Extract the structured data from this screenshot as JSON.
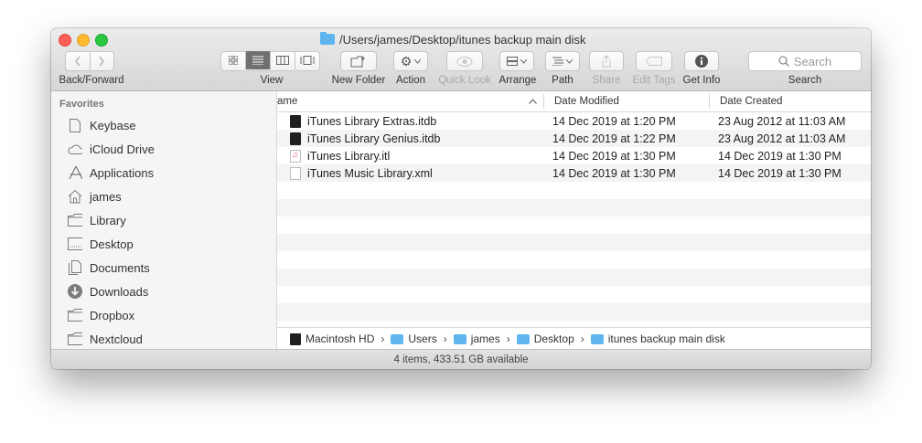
{
  "window": {
    "title": "/Users/james/Desktop/itunes backup main disk"
  },
  "toolbar": {
    "back_forward_label": "Back/Forward",
    "view_label": "View",
    "new_folder_label": "New Folder",
    "action_label": "Action",
    "quick_look_label": "Quick Look",
    "arrange_label": "Arrange",
    "path_label": "Path",
    "share_label": "Share",
    "edit_tags_label": "Edit Tags",
    "get_info_label": "Get Info",
    "search_label": "Search",
    "search_placeholder": "Search"
  },
  "sidebar": {
    "heading": "Favorites",
    "items": [
      {
        "label": "Keybase",
        "icon": "document-icon"
      },
      {
        "label": "iCloud Drive",
        "icon": "cloud-icon"
      },
      {
        "label": "Applications",
        "icon": "applications-icon"
      },
      {
        "label": "james",
        "icon": "home-icon"
      },
      {
        "label": "Library",
        "icon": "folder-icon"
      },
      {
        "label": "Desktop",
        "icon": "desktop-icon"
      },
      {
        "label": "Documents",
        "icon": "documents-icon"
      },
      {
        "label": "Downloads",
        "icon": "downloads-icon"
      },
      {
        "label": "Dropbox",
        "icon": "folder-icon"
      },
      {
        "label": "Nextcloud",
        "icon": "folder-icon"
      }
    ]
  },
  "columns": {
    "name": "ame",
    "date_modified": "Date Modified",
    "date_created": "Date Created"
  },
  "files": [
    {
      "name": "iTunes Library Extras.itdb",
      "modified": "14 Dec 2019 at 1:20 PM",
      "created": "23 Aug 2012 at 11:03 AM",
      "icon": "database-file-icon"
    },
    {
      "name": "iTunes Library Genius.itdb",
      "modified": "14 Dec 2019 at 1:22 PM",
      "created": "23 Aug 2012 at 11:03 AM",
      "icon": "database-file-icon"
    },
    {
      "name": "iTunes Library.itl",
      "modified": "14 Dec 2019 at 1:30 PM",
      "created": "14 Dec 2019 at 1:30 PM",
      "icon": "itunes-library-file-icon"
    },
    {
      "name": "iTunes Music Library.xml",
      "modified": "14 Dec 2019 at 1:30 PM",
      "created": "14 Dec 2019 at 1:30 PM",
      "icon": "xml-file-icon"
    }
  ],
  "path_bar": [
    "Macintosh HD",
    "Users",
    "james",
    "Desktop",
    "itunes backup main disk"
  ],
  "status": "4 items, 433.51 GB available"
}
